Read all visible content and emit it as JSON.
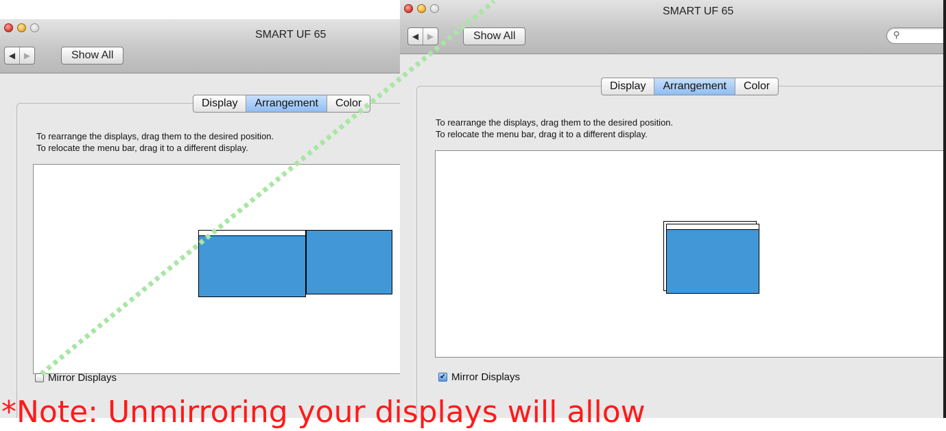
{
  "left_window": {
    "title": "SMART UF 65",
    "nav": {
      "back": "◀",
      "forward": "▶"
    },
    "show_all_label": "Show All",
    "tabs": [
      {
        "label": "Display",
        "selected": false
      },
      {
        "label": "Arrangement",
        "selected": true
      },
      {
        "label": "Color",
        "selected": false
      }
    ],
    "instructions": [
      "To rearrange the displays, drag them to the desired position.",
      "To relocate the menu bar, drag it to a different display."
    ],
    "mirror_label": "Mirror Displays",
    "mirror_checked": false
  },
  "right_window": {
    "title": "SMART UF 65",
    "nav": {
      "back": "◀",
      "forward": "▶"
    },
    "show_all_label": "Show All",
    "search_icon_glyph": "⚲",
    "tabs": [
      {
        "label": "Display",
        "selected": false
      },
      {
        "label": "Arrangement",
        "selected": true
      },
      {
        "label": "Color",
        "selected": false
      }
    ],
    "instructions": [
      "To rearrange the displays, drag them to the desired position.",
      "To relocate the menu bar, drag it to a different display."
    ],
    "mirror_label": "Mirror Displays",
    "mirror_checked": true,
    "checkmark_glyph": "✔"
  },
  "note_text": "*Note: Unmirroring your displays will allow",
  "colors": {
    "display_blue": "#4297d7",
    "selected_tab": "#8fbdf3",
    "note_red": "#ff1a1a",
    "dotted_line": "#a8e6a3"
  }
}
